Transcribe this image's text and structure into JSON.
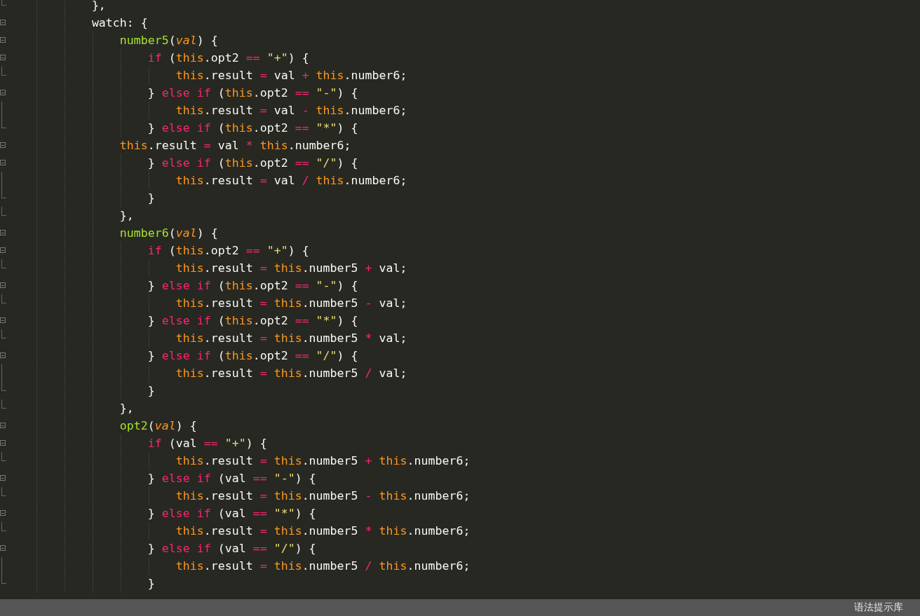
{
  "editor": {
    "lines": [
      {
        "kind": "fold_end",
        "tokens": [
          {
            "kind": "plain",
            "text": "            },"
          }
        ]
      },
      {
        "kind": "fold_start",
        "tokens": [
          {
            "kind": "plain",
            "text": "            watch: {"
          }
        ]
      },
      {
        "kind": "fold_start",
        "tokens": [
          {
            "kind": "function",
            "text": "                number5"
          },
          {
            "kind": "plain",
            "text": "("
          },
          {
            "kind": "parameter",
            "text": "val"
          },
          {
            "kind": "plain",
            "text": ") {"
          }
        ]
      },
      {
        "kind": "fold_start",
        "tokens": [
          {
            "kind": "keyword",
            "text": "                    if"
          },
          {
            "kind": "plain",
            "text": " ("
          },
          {
            "kind": "this",
            "text": "this"
          },
          {
            "kind": "plain",
            "text": ".opt2 "
          },
          {
            "kind": "keyword",
            "text": "=="
          },
          {
            "kind": "string",
            "text": " \"+\""
          },
          {
            "kind": "plain",
            "text": ") {"
          }
        ]
      },
      {
        "kind": "fold_end",
        "tokens": [
          {
            "kind": "this",
            "text": "                        this"
          },
          {
            "kind": "plain",
            "text": ".result "
          },
          {
            "kind": "keyword",
            "text": "="
          },
          {
            "kind": "plain",
            "text": " val "
          },
          {
            "kind": "keyword",
            "text": "+"
          },
          {
            "kind": "this",
            "text": " this"
          },
          {
            "kind": "plain",
            "text": ".number6;"
          }
        ]
      },
      {
        "kind": "fold_start",
        "tokens": [
          {
            "kind": "plain",
            "text": "                    } "
          },
          {
            "kind": "keyword",
            "text": "else if"
          },
          {
            "kind": "plain",
            "text": " ("
          },
          {
            "kind": "this",
            "text": "this"
          },
          {
            "kind": "plain",
            "text": ".opt2 "
          },
          {
            "kind": "keyword",
            "text": "=="
          },
          {
            "kind": "string",
            "text": " \"-\""
          },
          {
            "kind": "plain",
            "text": ") {"
          }
        ]
      },
      {
        "kind": "fold_body",
        "tokens": [
          {
            "kind": "this",
            "text": "                        this"
          },
          {
            "kind": "plain",
            "text": ".result "
          },
          {
            "kind": "keyword",
            "text": "="
          },
          {
            "kind": "plain",
            "text": " val "
          },
          {
            "kind": "keyword",
            "text": "-"
          },
          {
            "kind": "this",
            "text": " this"
          },
          {
            "kind": "plain",
            "text": ".number6;"
          }
        ]
      },
      {
        "kind": "fold_end",
        "tokens": [
          {
            "kind": "plain",
            "text": "                    } "
          },
          {
            "kind": "keyword",
            "text": "else if"
          },
          {
            "kind": "plain",
            "text": " ("
          },
          {
            "kind": "this",
            "text": "this"
          },
          {
            "kind": "plain",
            "text": ".opt2 "
          },
          {
            "kind": "keyword",
            "text": "=="
          },
          {
            "kind": "string",
            "text": " \"*\""
          },
          {
            "kind": "plain",
            "text": ") {"
          }
        ]
      },
      {
        "kind": "fold_start",
        "tokens": [
          {
            "kind": "this",
            "text": "                this"
          },
          {
            "kind": "plain",
            "text": ".result "
          },
          {
            "kind": "keyword",
            "text": "="
          },
          {
            "kind": "plain",
            "text": " val "
          },
          {
            "kind": "keyword",
            "text": "*"
          },
          {
            "kind": "this",
            "text": " this"
          },
          {
            "kind": "plain",
            "text": ".number6;"
          }
        ]
      },
      {
        "kind": "fold_start",
        "tokens": [
          {
            "kind": "plain",
            "text": "                    } "
          },
          {
            "kind": "keyword",
            "text": "else if"
          },
          {
            "kind": "plain",
            "text": " ("
          },
          {
            "kind": "this",
            "text": "this"
          },
          {
            "kind": "plain",
            "text": ".opt2 "
          },
          {
            "kind": "keyword",
            "text": "=="
          },
          {
            "kind": "string",
            "text": " \"/\""
          },
          {
            "kind": "plain",
            "text": ") {"
          }
        ]
      },
      {
        "kind": "fold_body",
        "tokens": [
          {
            "kind": "this",
            "text": "                        this"
          },
          {
            "kind": "plain",
            "text": ".result "
          },
          {
            "kind": "keyword",
            "text": "="
          },
          {
            "kind": "plain",
            "text": " val "
          },
          {
            "kind": "keyword",
            "text": "/"
          },
          {
            "kind": "this",
            "text": " this"
          },
          {
            "kind": "plain",
            "text": ".number6;"
          }
        ]
      },
      {
        "kind": "fold_end",
        "tokens": [
          {
            "kind": "plain",
            "text": "                    }"
          }
        ]
      },
      {
        "kind": "fold_end",
        "tokens": [
          {
            "kind": "plain",
            "text": "                },"
          }
        ]
      },
      {
        "kind": "fold_start",
        "tokens": [
          {
            "kind": "function",
            "text": "                number6"
          },
          {
            "kind": "plain",
            "text": "("
          },
          {
            "kind": "parameter",
            "text": "val"
          },
          {
            "kind": "plain",
            "text": ") {"
          }
        ]
      },
      {
        "kind": "fold_start",
        "tokens": [
          {
            "kind": "keyword",
            "text": "                    if"
          },
          {
            "kind": "plain",
            "text": " ("
          },
          {
            "kind": "this",
            "text": "this"
          },
          {
            "kind": "plain",
            "text": ".opt2 "
          },
          {
            "kind": "keyword",
            "text": "=="
          },
          {
            "kind": "string",
            "text": " \"+\""
          },
          {
            "kind": "plain",
            "text": ") {"
          }
        ]
      },
      {
        "kind": "fold_end",
        "tokens": [
          {
            "kind": "this",
            "text": "                        this"
          },
          {
            "kind": "plain",
            "text": ".result "
          },
          {
            "kind": "keyword",
            "text": "="
          },
          {
            "kind": "this",
            "text": " this"
          },
          {
            "kind": "plain",
            "text": ".number5 "
          },
          {
            "kind": "keyword",
            "text": "+"
          },
          {
            "kind": "plain",
            "text": " val;"
          }
        ]
      },
      {
        "kind": "fold_start",
        "tokens": [
          {
            "kind": "plain",
            "text": "                    } "
          },
          {
            "kind": "keyword",
            "text": "else if"
          },
          {
            "kind": "plain",
            "text": " ("
          },
          {
            "kind": "this",
            "text": "this"
          },
          {
            "kind": "plain",
            "text": ".opt2 "
          },
          {
            "kind": "keyword",
            "text": "=="
          },
          {
            "kind": "string",
            "text": " \"-\""
          },
          {
            "kind": "plain",
            "text": ") {"
          }
        ]
      },
      {
        "kind": "fold_end",
        "tokens": [
          {
            "kind": "this",
            "text": "                        this"
          },
          {
            "kind": "plain",
            "text": ".result "
          },
          {
            "kind": "keyword",
            "text": "="
          },
          {
            "kind": "this",
            "text": " this"
          },
          {
            "kind": "plain",
            "text": ".number5 "
          },
          {
            "kind": "keyword",
            "text": "-"
          },
          {
            "kind": "plain",
            "text": " val;"
          }
        ]
      },
      {
        "kind": "fold_start",
        "tokens": [
          {
            "kind": "plain",
            "text": "                    } "
          },
          {
            "kind": "keyword",
            "text": "else if"
          },
          {
            "kind": "plain",
            "text": " ("
          },
          {
            "kind": "this",
            "text": "this"
          },
          {
            "kind": "plain",
            "text": ".opt2 "
          },
          {
            "kind": "keyword",
            "text": "=="
          },
          {
            "kind": "string",
            "text": " \"*\""
          },
          {
            "kind": "plain",
            "text": ") {"
          }
        ]
      },
      {
        "kind": "fold_end",
        "tokens": [
          {
            "kind": "this",
            "text": "                        this"
          },
          {
            "kind": "plain",
            "text": ".result "
          },
          {
            "kind": "keyword",
            "text": "="
          },
          {
            "kind": "this",
            "text": " this"
          },
          {
            "kind": "plain",
            "text": ".number5 "
          },
          {
            "kind": "keyword",
            "text": "*"
          },
          {
            "kind": "plain",
            "text": " val;"
          }
        ]
      },
      {
        "kind": "fold_start",
        "tokens": [
          {
            "kind": "plain",
            "text": "                    } "
          },
          {
            "kind": "keyword",
            "text": "else if"
          },
          {
            "kind": "plain",
            "text": " ("
          },
          {
            "kind": "this",
            "text": "this"
          },
          {
            "kind": "plain",
            "text": ".opt2 "
          },
          {
            "kind": "keyword",
            "text": "=="
          },
          {
            "kind": "string",
            "text": " \"/\""
          },
          {
            "kind": "plain",
            "text": ") {"
          }
        ]
      },
      {
        "kind": "fold_body",
        "tokens": [
          {
            "kind": "this",
            "text": "                        this"
          },
          {
            "kind": "plain",
            "text": ".result "
          },
          {
            "kind": "keyword",
            "text": "="
          },
          {
            "kind": "this",
            "text": " this"
          },
          {
            "kind": "plain",
            "text": ".number5 "
          },
          {
            "kind": "keyword",
            "text": "/"
          },
          {
            "kind": "plain",
            "text": " val;"
          }
        ]
      },
      {
        "kind": "fold_end",
        "tokens": [
          {
            "kind": "plain",
            "text": "                    }"
          }
        ]
      },
      {
        "kind": "fold_end",
        "tokens": [
          {
            "kind": "plain",
            "text": "                },"
          }
        ]
      },
      {
        "kind": "fold_start",
        "tokens": [
          {
            "kind": "function",
            "text": "                opt2"
          },
          {
            "kind": "plain",
            "text": "("
          },
          {
            "kind": "parameter",
            "text": "val"
          },
          {
            "kind": "plain",
            "text": ") {"
          }
        ]
      },
      {
        "kind": "fold_start",
        "tokens": [
          {
            "kind": "keyword",
            "text": "                    if"
          },
          {
            "kind": "plain",
            "text": " (val "
          },
          {
            "kind": "keyword",
            "text": "=="
          },
          {
            "kind": "string",
            "text": " \"+\""
          },
          {
            "kind": "plain",
            "text": ") {"
          }
        ]
      },
      {
        "kind": "fold_end",
        "tokens": [
          {
            "kind": "this",
            "text": "                        this"
          },
          {
            "kind": "plain",
            "text": ".result "
          },
          {
            "kind": "keyword",
            "text": "="
          },
          {
            "kind": "this",
            "text": " this"
          },
          {
            "kind": "plain",
            "text": ".number5 "
          },
          {
            "kind": "keyword",
            "text": "+"
          },
          {
            "kind": "this",
            "text": " this"
          },
          {
            "kind": "plain",
            "text": ".number6;"
          }
        ]
      },
      {
        "kind": "fold_start",
        "tokens": [
          {
            "kind": "plain",
            "text": "                    } "
          },
          {
            "kind": "keyword",
            "text": "else if"
          },
          {
            "kind": "plain",
            "text": " (val "
          },
          {
            "kind": "keyword",
            "text": "=="
          },
          {
            "kind": "string",
            "text": " \"-\""
          },
          {
            "kind": "plain",
            "text": ") {"
          }
        ]
      },
      {
        "kind": "fold_end",
        "tokens": [
          {
            "kind": "this",
            "text": "                        this"
          },
          {
            "kind": "plain",
            "text": ".result "
          },
          {
            "kind": "keyword",
            "text": "="
          },
          {
            "kind": "this",
            "text": " this"
          },
          {
            "kind": "plain",
            "text": ".number5 "
          },
          {
            "kind": "keyword",
            "text": "-"
          },
          {
            "kind": "this",
            "text": " this"
          },
          {
            "kind": "plain",
            "text": ".number6;"
          }
        ]
      },
      {
        "kind": "fold_start",
        "tokens": [
          {
            "kind": "plain",
            "text": "                    } "
          },
          {
            "kind": "keyword",
            "text": "else if"
          },
          {
            "kind": "plain",
            "text": " (val "
          },
          {
            "kind": "keyword",
            "text": "=="
          },
          {
            "kind": "string",
            "text": " \"*\""
          },
          {
            "kind": "plain",
            "text": ") {"
          }
        ]
      },
      {
        "kind": "fold_end",
        "tokens": [
          {
            "kind": "this",
            "text": "                        this"
          },
          {
            "kind": "plain",
            "text": ".result "
          },
          {
            "kind": "keyword",
            "text": "="
          },
          {
            "kind": "this",
            "text": " this"
          },
          {
            "kind": "plain",
            "text": ".number5 "
          },
          {
            "kind": "keyword",
            "text": "*"
          },
          {
            "kind": "this",
            "text": " this"
          },
          {
            "kind": "plain",
            "text": ".number6;"
          }
        ]
      },
      {
        "kind": "fold_start",
        "tokens": [
          {
            "kind": "plain",
            "text": "                    } "
          },
          {
            "kind": "keyword",
            "text": "else if"
          },
          {
            "kind": "plain",
            "text": " (val "
          },
          {
            "kind": "keyword",
            "text": "=="
          },
          {
            "kind": "string",
            "text": " \"/\""
          },
          {
            "kind": "plain",
            "text": ") {"
          }
        ]
      },
      {
        "kind": "fold_body",
        "tokens": [
          {
            "kind": "this",
            "text": "                        this"
          },
          {
            "kind": "plain",
            "text": ".result "
          },
          {
            "kind": "keyword",
            "text": "="
          },
          {
            "kind": "this",
            "text": " this"
          },
          {
            "kind": "plain",
            "text": ".number5 "
          },
          {
            "kind": "keyword",
            "text": "/"
          },
          {
            "kind": "this",
            "text": " this"
          },
          {
            "kind": "plain",
            "text": ".number6;"
          }
        ]
      },
      {
        "kind": "fold_end",
        "tokens": [
          {
            "kind": "plain",
            "text": "                    }"
          }
        ]
      }
    ]
  },
  "status_bar": {
    "label": "语法提示库"
  }
}
